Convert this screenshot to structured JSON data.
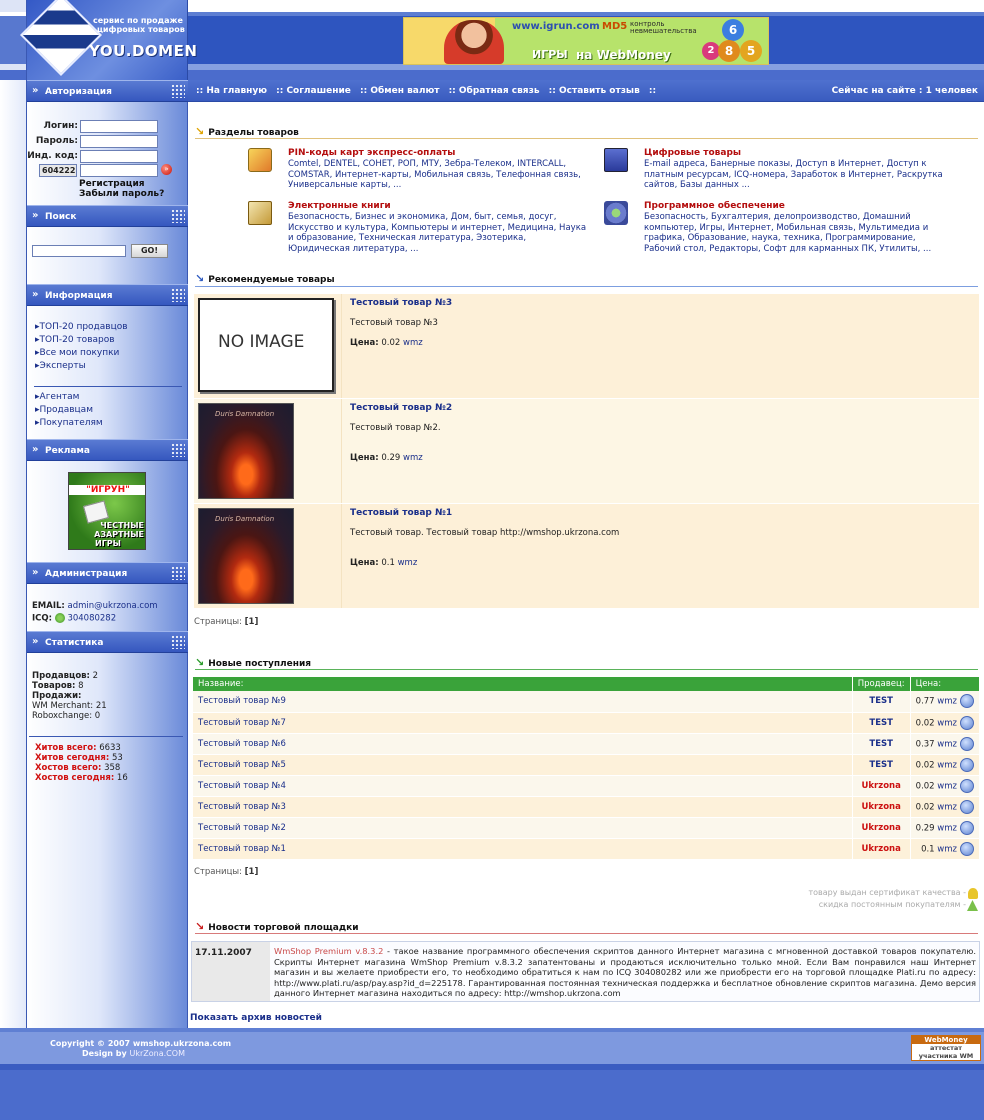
{
  "header": {
    "logo_tagline_1": "сервис по продаже",
    "logo_tagline_2": "цифровых товаров",
    "logo_brand": "YOU.DOMEN",
    "banner": {
      "site": "www.igrun.com",
      "md5": "MD5",
      "md5_sub": "контроль невмешательства",
      "games": "ИГРЫ",
      "on_webmoney": "на WebMoney",
      "balls": [
        "6",
        "2",
        "8",
        "5"
      ]
    }
  },
  "nav": {
    "links": [
      ":: На главную",
      ":: Соглашение",
      ":: Обмен валют",
      ":: Обратная связь",
      ":: Оставить отзыв",
      "::"
    ],
    "online": "Сейчас на сайте : 1 человек"
  },
  "sidebar": {
    "auth": {
      "title": "Авторизация",
      "login_label": "Логин:",
      "password_label": "Пароль:",
      "id_label": "Инд. код:",
      "captcha": "604222",
      "register": "Регистрация",
      "forgot": "Забыли пароль?"
    },
    "search": {
      "title": "Поиск",
      "button": "GO!"
    },
    "info": {
      "title": "Информация",
      "items": [
        "ТОП-20 продавцов",
        "ТОП-20 товаров",
        "Все мои покупки",
        "Эксперты"
      ],
      "items2": [
        "Агентам",
        "Продавцам",
        "Покупателям"
      ]
    },
    "ads": {
      "title": "Реклама",
      "banner_line1": "\"ИГРУН\"",
      "banner_line2": "ЧЕСТНЫЕ",
      "banner_line3": "АЗАРТНЫЕ",
      "banner_line4": "ИГРЫ"
    },
    "admin": {
      "title": "Администрация",
      "email_label": "EMAIL:",
      "email": "admin@ukrzona.com",
      "icq_label": "ICQ:",
      "icq": "304080282"
    },
    "stats": {
      "title": "Статистика",
      "sellers_label": "Продавцов:",
      "sellers": "2",
      "goods_label": "Товаров:",
      "goods": "8",
      "sales_label": "Продажи:",
      "wm_label": "WM Merchant:",
      "wm": "21",
      "robox_label": "Roboxchange:",
      "robox": "0",
      "hits_total_label": "Хитов всего:",
      "hits_total": "6633",
      "hits_today_label": "Хитов сегодня:",
      "hits_today": "53",
      "hosts_total_label": "Хостов всего:",
      "hosts_total": "358",
      "hosts_today_label": "Хостов сегодня:",
      "hosts_today": "16"
    }
  },
  "sections": {
    "title": "Разделы товаров",
    "items": [
      {
        "name": "PIN-коды карт экспресс-оплаты",
        "desc": "Comtel, DENTEL, СОНЕТ, РОП, МТУ, Зебра-Телеком, INTERCALL, COMSTAR, Интернет-карты, Мобильная связь, Телефонная связь, Универсальные карты, ..."
      },
      {
        "name": "Цифровые товары",
        "desc": "E-mail адреса, Банерные показы, Доступ в Интернет, Доступ к платным ресурсам, ICQ-номера, Заработок в Интернет, Раскрутка сайтов, Базы данных ..."
      },
      {
        "name": "Электронные книги",
        "desc": "Безопасность, Бизнес и экономика, Дом, быт, семья, досуг, Искусство и культура, Компьютеры и интернет, Медицина, Наука и образование, Техническая литература, Эзотерика, Юридическая литература, ..."
      },
      {
        "name": "Программное обеспечение",
        "desc": "Безопасность, Бухгалтерия, делопроизводство, Домашний компьютер, Игры, Интернет, Мобильная связь, Мультимедиа и графика, Образование, наука, техника, Программирование, Рабочий стол, Редакторы, Софт для карманных ПК, Утилиты, ..."
      }
    ]
  },
  "recommended": {
    "title": "Рекомендуемые товары",
    "no_image": "NO IMAGE",
    "cover_title": "Duris Damnation",
    "price_label": "Цена:",
    "items": [
      {
        "name": "Тестовый товар №3",
        "desc": "Тестовый товар №3",
        "price": "0.02",
        "currency": "wmz"
      },
      {
        "name": "Тестовый товар №2",
        "desc": "Тестовый товар №2.",
        "price": "0.29",
        "currency": "wmz"
      },
      {
        "name": "Тестовый товар №1",
        "desc": "Тестовый товар. Тестовый товар http://wmshop.ukrzona.com",
        "price": "0.1",
        "currency": "wmz"
      }
    ],
    "pages_label": "Страницы:",
    "pages": "[1]"
  },
  "new_arrivals": {
    "title": "Новые поступления",
    "columns": [
      "Название:",
      "Продавец:",
      "Цена:"
    ],
    "rows": [
      {
        "name": "Тестовый товар №9",
        "seller": "TEST",
        "price": "0.77",
        "currency": "wmz"
      },
      {
        "name": "Тестовый товар №7",
        "seller": "TEST",
        "price": "0.02",
        "currency": "wmz"
      },
      {
        "name": "Тестовый товар №6",
        "seller": "TEST",
        "price": "0.37",
        "currency": "wmz"
      },
      {
        "name": "Тестовый товар №5",
        "seller": "TEST",
        "price": "0.02",
        "currency": "wmz"
      },
      {
        "name": "Тестовый товар №4",
        "seller": "Ukrzona",
        "price": "0.02",
        "currency": "wmz"
      },
      {
        "name": "Тестовый товар №3",
        "seller": "Ukrzona",
        "price": "0.02",
        "currency": "wmz"
      },
      {
        "name": "Тестовый товар №2",
        "seller": "Ukrzona",
        "price": "0.29",
        "currency": "wmz"
      },
      {
        "name": "Тестовый товар №1",
        "seller": "Ukrzona",
        "price": "0.1",
        "currency": "wmz"
      }
    ],
    "pages_label": "Страницы:",
    "pages": "[1]",
    "legend_quality": "товару выдан сертификат качества -",
    "legend_discount": "скидка постоянным покупателям -"
  },
  "news": {
    "title": "Новости торговой площадки",
    "date": "17.11.2007",
    "link": "WmShop Premium v.8.3.2",
    "text": " - такое название программного обеспечения скриптов данного Интернет магазина с мгновенной доставкой товаров покупателю. Скрипты Интернет магазина WmShop Premium v.8.3.2 запатентованы и продаються исключительно только мной. Если Вам понравился наш Интернет магазин и вы желаете приобрести его, то необходимо обратиться к нам по ICQ 304080282 или же приобрести его на торговой площадке Plati.ru по адресу: http://www.plati.ru/asp/pay.asp?id_d=225178. Гарантированная постоянная техническая поддержка и бесплатное обновление скриптов магазина. Демо версия данного Интернет магазина находиться по адресу: http://wmshop.ukrzona.com",
    "archive": "Показать архив новостей"
  },
  "footer": {
    "copyright": "Copyright © 2007 wmshop.ukrzona.com",
    "design_label": "Design by",
    "design_by": "UkrZona.COM",
    "badge_top": "WebMoney",
    "badge_bottom": "аттестат участника WM"
  },
  "colors": {
    "nav_blue": "#3a5cbf",
    "table_green": "#3aa33a",
    "seller_test": "#1a2f8a",
    "seller_ukrzona": "#cc1111",
    "category_red": "#b40d0d",
    "row_cream": "#fdf1da"
  }
}
